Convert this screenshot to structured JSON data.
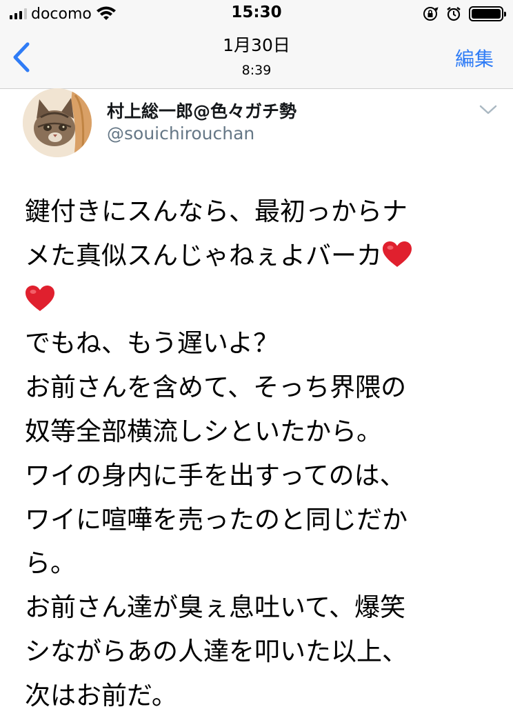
{
  "status_bar": {
    "carrier": "docomo",
    "time": "15:30",
    "signal_bars": 3,
    "icons": [
      "signal-icon",
      "wifi-icon",
      "orientation-lock-icon",
      "alarm-icon",
      "battery-icon"
    ]
  },
  "nav": {
    "date": "1月30日",
    "time": "8:39",
    "edit_label": "編集",
    "accent_color": "#2f7cf6",
    "back_icon": "chevron-left-icon"
  },
  "tweet": {
    "display_name": "村上総一郎@色々ガチ勢",
    "handle": "@souichirouchan",
    "avatar": "cat-avatar",
    "menu_icon": "chevron-down-icon",
    "lines": [
      "鍵付きにスんなら、最初っからナ",
      "メた真似スんじゃねぇよバーカ",
      "",
      "でもね、もう遅いよ？",
      "お前さんを含めて、そっち界隈の",
      "奴等全部横流しシといたから。",
      "ワイの身内に手を出すってのは、",
      "ワイに喧嘩を売ったのと同じだか",
      "ら。",
      "お前さん達が臭ぇ息吐いて、爆笑",
      "シながらあの人達を叩いた以上、",
      "次はお前だ。"
    ],
    "emoji": "heart-emoji"
  }
}
